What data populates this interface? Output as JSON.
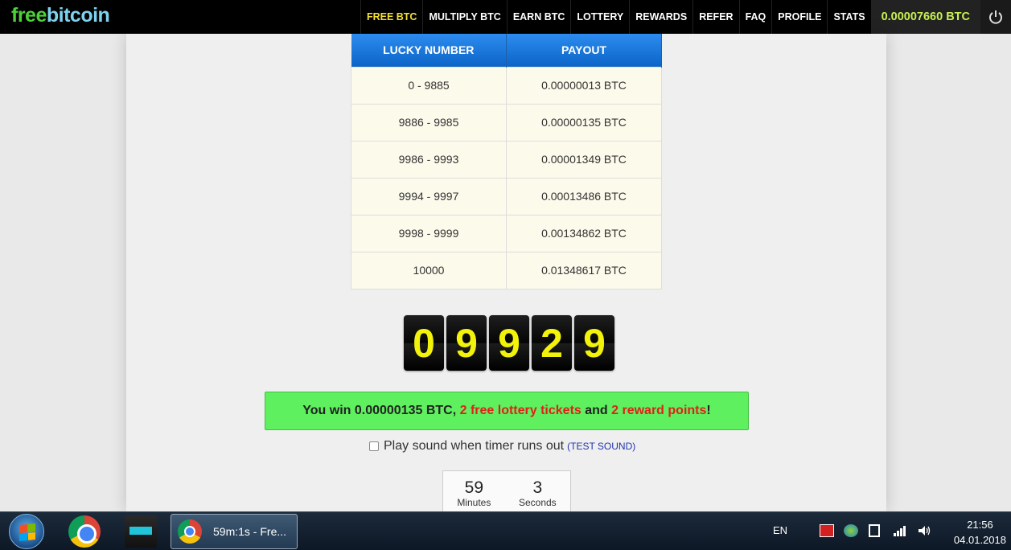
{
  "brand": {
    "logo_part1": "free",
    "logo_part2": "bitcoin"
  },
  "nav": {
    "items": [
      "FREE BTC",
      "MULTIPLY BTC",
      "EARN BTC",
      "LOTTERY",
      "REWARDS",
      "REFER",
      "FAQ",
      "PROFILE",
      "STATS"
    ],
    "active_index": 0,
    "balance": "0.00007660 BTC"
  },
  "payout_table": {
    "headers": [
      "LUCKY NUMBER",
      "PAYOUT"
    ],
    "rows": [
      [
        "0 - 9885",
        "0.00000013 BTC"
      ],
      [
        "9886 - 9985",
        "0.00000135 BTC"
      ],
      [
        "9986 - 9993",
        "0.00001349 BTC"
      ],
      [
        "9994 - 9997",
        "0.00013486 BTC"
      ],
      [
        "9998 - 9999",
        "0.00134862 BTC"
      ],
      [
        "10000",
        "0.01348617 BTC"
      ]
    ]
  },
  "lucky_digits": [
    "0",
    "9",
    "9",
    "2",
    "9"
  ],
  "win_message": {
    "part1": "You win 0.00000135 BTC, ",
    "tickets": "2 free lottery tickets",
    "part2": " and ",
    "points": "2 reward points",
    "part3": "!"
  },
  "sound_option": {
    "label": "Play sound when timer runs out",
    "test_link": "TEST SOUND",
    "checked": false
  },
  "timer": {
    "minutes": "59",
    "minutes_label": "Minutes",
    "seconds": "3",
    "seconds_label": "Seconds"
  },
  "taskbar": {
    "window_title": "59m:1s - Fre...",
    "language": "EN",
    "time": "21:56",
    "date": "04.01.2018"
  },
  "colors": {
    "nav_active": "#f6e033",
    "balance": "#c7f051",
    "table_header": "#1177dd",
    "win_background": "#5ef05e",
    "win_highlight": "#e0201a",
    "digit_color": "#f2f20a"
  }
}
